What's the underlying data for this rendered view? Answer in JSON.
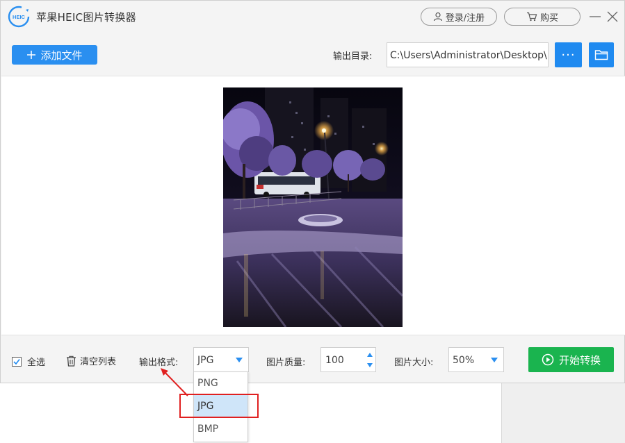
{
  "window": {
    "title": "苹果HEIC图片转换器",
    "logo_text": "HEIC",
    "login_label": "登录/注册",
    "buy_label": "购买"
  },
  "toolbar": {
    "add_file_label": "添加文件",
    "output_dir_label": "输出目录:",
    "output_dir_value": "C:\\Users\\Administrator\\Desktop\\",
    "more_label": "···"
  },
  "bottom_bar": {
    "select_all_label": "全选",
    "select_all_checked": true,
    "clear_list_label": "清空列表",
    "format_label": "输出格式:",
    "format_value": "JPG",
    "quality_label": "图片质量:",
    "quality_value": "100",
    "size_label": "图片大小:",
    "size_value": "50%",
    "start_label": "开始转换"
  },
  "format_dropdown": {
    "options": [
      "PNG",
      "JPG",
      "BMP"
    ],
    "selected": "JPG"
  },
  "colors": {
    "accent_blue": "#1f8af0",
    "start_green": "#1ab44f",
    "annotation_red": "#e02020",
    "selected_bg": "#cfe5f9"
  },
  "icons": {
    "login": "user-icon",
    "buy": "cart-icon",
    "add": "plus-icon",
    "more": "ellipsis-icon",
    "folder": "folder-icon",
    "clear": "trash-icon",
    "start": "play-circle-icon"
  }
}
